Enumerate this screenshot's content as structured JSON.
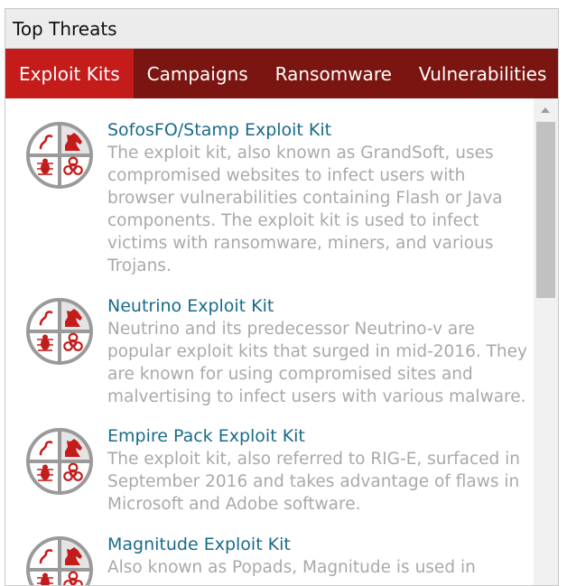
{
  "header": {
    "title": "Top Threats"
  },
  "tabs": [
    {
      "label": "Exploit Kits",
      "active": true
    },
    {
      "label": "Campaigns",
      "active": false
    },
    {
      "label": "Ransomware",
      "active": false
    },
    {
      "label": "Vulnerabilities",
      "active": false
    }
  ],
  "items": [
    {
      "name": "SofosFO/Stamp Exploit Kit",
      "desc": "The exploit kit, also known as GrandSoft, uses compromised websites to infect users with browser vulnerabilities containing Flash or Java components. The exploit kit is used to infect victims with ransomware, miners, and various Trojans.",
      "icon": "threat-quadrant-icon"
    },
    {
      "name": "Neutrino Exploit Kit",
      "desc": "Neutrino and its predecessor Neutrino-v are popular exploit kits that surged in mid-2016. They are known for using compromised sites and malvertising to infect users with various malware.",
      "icon": "threat-quadrant-icon"
    },
    {
      "name": "Empire Pack Exploit Kit",
      "desc": "The exploit kit, also referred to RIG-E, surfaced in September 2016 and takes advantage of flaws in Microsoft and Adobe software.",
      "icon": "threat-quadrant-icon"
    },
    {
      "name": "Magnitude Exploit Kit",
      "desc": "Also known as Popads, Magnitude is used in",
      "icon": "threat-quadrant-icon"
    }
  ],
  "colors": {
    "tab_bar": "#7a1511",
    "tab_active": "#c41b1b",
    "item_title": "#1a6a8a",
    "item_desc": "#a9a9a9",
    "icon_red": "#c41b1b",
    "icon_gray": "#9a9a9a"
  }
}
